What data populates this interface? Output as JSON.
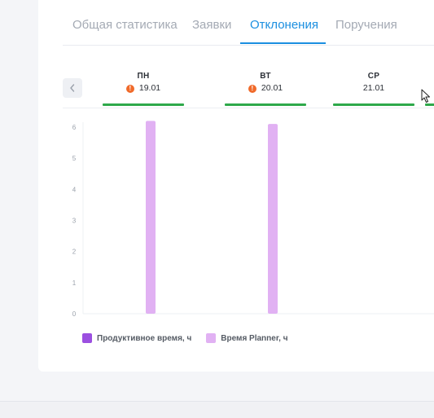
{
  "tabs": [
    {
      "label": "Общая статистика",
      "active": false
    },
    {
      "label": "Заявки",
      "active": false
    },
    {
      "label": "Отклонения",
      "active": true
    },
    {
      "label": "Поручения",
      "active": false
    }
  ],
  "colors": {
    "accent": "#1b8fe0",
    "day_ok_line": "#2ea94a",
    "warning": "#f06a2a",
    "productive": "#9b4fe0",
    "planner": "#e1b1f3"
  },
  "days": [
    {
      "name": "ПН",
      "date": "19.01",
      "warning": true
    },
    {
      "name": "ВТ",
      "date": "20.01",
      "warning": true
    },
    {
      "name": "СР",
      "date": "21.01",
      "warning": false
    }
  ],
  "chart_data": {
    "type": "bar",
    "categories": [
      "ПН",
      "ВТ",
      "СР"
    ],
    "series": [
      {
        "name": "Продуктивное время, ч",
        "values": [
          0,
          0,
          0
        ]
      },
      {
        "name": "Время Planner, ч",
        "values": [
          6.2,
          6.1,
          0
        ]
      }
    ],
    "ylim": [
      0,
      6
    ],
    "yticks": [
      "0",
      "1",
      "2",
      "3",
      "4",
      "5",
      "6"
    ],
    "grid": false,
    "legend_position": "bottom-left"
  },
  "legend": [
    {
      "label": "Продуктивное время, ч",
      "color": "#9b4fe0"
    },
    {
      "label": "Время Planner, ч",
      "color": "#e1b1f3"
    }
  ],
  "icons": {
    "prev": "chevron-left-icon",
    "warning": "exclamation-icon",
    "cursor": "mouse-pointer-icon"
  }
}
